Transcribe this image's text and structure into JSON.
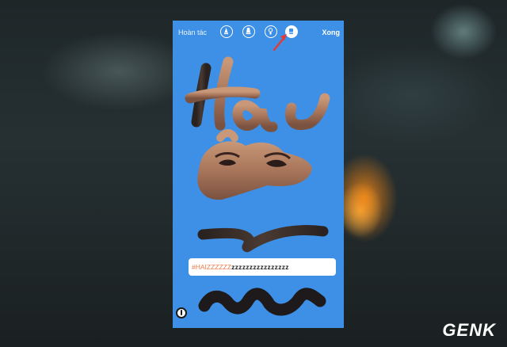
{
  "toolbar": {
    "undo_label": "Hoàn tác",
    "done_label": "Xong",
    "tools": [
      "pen-tool-icon",
      "marker-tool-icon",
      "neon-tool-icon",
      "eraser-tool-icon"
    ],
    "active_tool": "eraser-tool-icon"
  },
  "canvas": {
    "background_color": "#3d90e5",
    "handwritten_text": "Hai",
    "hashtag_sticker": {
      "tag": "#HAIZZZZZZ",
      "trailing": "zzzzzzzzzzzzzzzz"
    }
  },
  "watermark": {
    "brand_main": "GEN",
    "brand_accent": "K"
  },
  "colors": {
    "accent_arrow": "#e53935",
    "hashtag_text": "#f07848",
    "brand_accent": "#e53935"
  }
}
